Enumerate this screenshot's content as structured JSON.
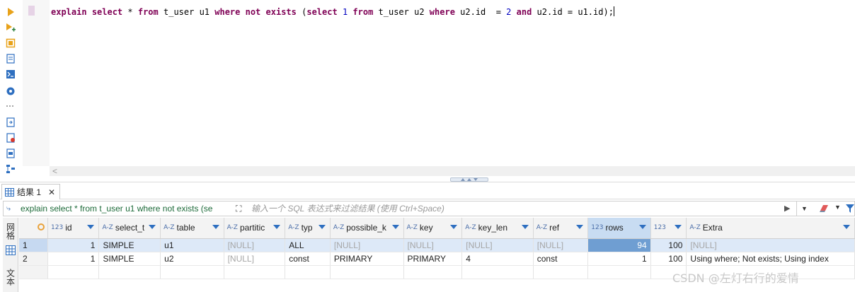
{
  "editor": {
    "sql_tokens": [
      {
        "t": "explain",
        "c": "kw"
      },
      {
        "t": " ",
        "c": "plain"
      },
      {
        "t": "select",
        "c": "kw"
      },
      {
        "t": " * ",
        "c": "plain"
      },
      {
        "t": "from",
        "c": "kw"
      },
      {
        "t": " t_user u1 ",
        "c": "plain"
      },
      {
        "t": "where",
        "c": "kw"
      },
      {
        "t": " ",
        "c": "plain"
      },
      {
        "t": "not",
        "c": "kw"
      },
      {
        "t": " ",
        "c": "plain"
      },
      {
        "t": "exists",
        "c": "kw"
      },
      {
        "t": " (",
        "c": "plain"
      },
      {
        "t": "select",
        "c": "kw"
      },
      {
        "t": " ",
        "c": "plain"
      },
      {
        "t": "1",
        "c": "num"
      },
      {
        "t": " ",
        "c": "plain"
      },
      {
        "t": "from",
        "c": "kw"
      },
      {
        "t": " t_user u2 ",
        "c": "plain"
      },
      {
        "t": "where",
        "c": "kw"
      },
      {
        "t": " u2.id  = ",
        "c": "plain"
      },
      {
        "t": "2",
        "c": "num"
      },
      {
        "t": " ",
        "c": "plain"
      },
      {
        "t": "and",
        "c": "kw"
      },
      {
        "t": " u2.id = u1.id);",
        "c": "plain"
      }
    ],
    "toolbar_icons": [
      "execute-statement-icon",
      "execute-script-icon",
      "explain-plan-icon",
      "load-execution-plan-icon",
      "console-icon",
      "settings-icon",
      "more-icon",
      "export-icon",
      "new-script-icon",
      "format-icon",
      "outline-icon"
    ]
  },
  "result_tab": {
    "label": "结果 1",
    "close": "✕"
  },
  "filter": {
    "query_text": "explain select * from t_user u1 where not exists (se",
    "placeholder": "输入一个 SQL 表达式来过滤结果 (使用 Ctrl+Space)"
  },
  "side_tabs": [
    {
      "label": "网格"
    },
    {
      "label": "文本"
    }
  ],
  "grid": {
    "columns": [
      {
        "name": "id",
        "type": "123"
      },
      {
        "name": "select_t",
        "type": "A-Z"
      },
      {
        "name": "table",
        "type": "A-Z"
      },
      {
        "name": "partitic",
        "type": "A-Z"
      },
      {
        "name": "typ",
        "type": "A-Z"
      },
      {
        "name": "possible_k",
        "type": "A-Z"
      },
      {
        "name": "key",
        "type": "A-Z"
      },
      {
        "name": "key_len",
        "type": "A-Z"
      },
      {
        "name": "ref",
        "type": "A-Z"
      },
      {
        "name": "rows",
        "type": "123"
      },
      {
        "name": "",
        "type": "123"
      },
      {
        "name": "Extra",
        "type": "A-Z"
      }
    ],
    "rows": [
      {
        "num": "1",
        "cells": [
          "1",
          "SIMPLE",
          "u1",
          "[NULL]",
          "ALL",
          "[NULL]",
          "[NULL]",
          "[NULL]",
          "[NULL]",
          "94",
          "100",
          "[NULL]"
        ]
      },
      {
        "num": "2",
        "cells": [
          "1",
          "SIMPLE",
          "u2",
          "[NULL]",
          "const",
          "PRIMARY",
          "PRIMARY",
          "4",
          "const",
          "1",
          "100",
          "Using where; Not exists; Using index"
        ]
      }
    ]
  },
  "watermark": "CSDN @左灯右行的爱情"
}
